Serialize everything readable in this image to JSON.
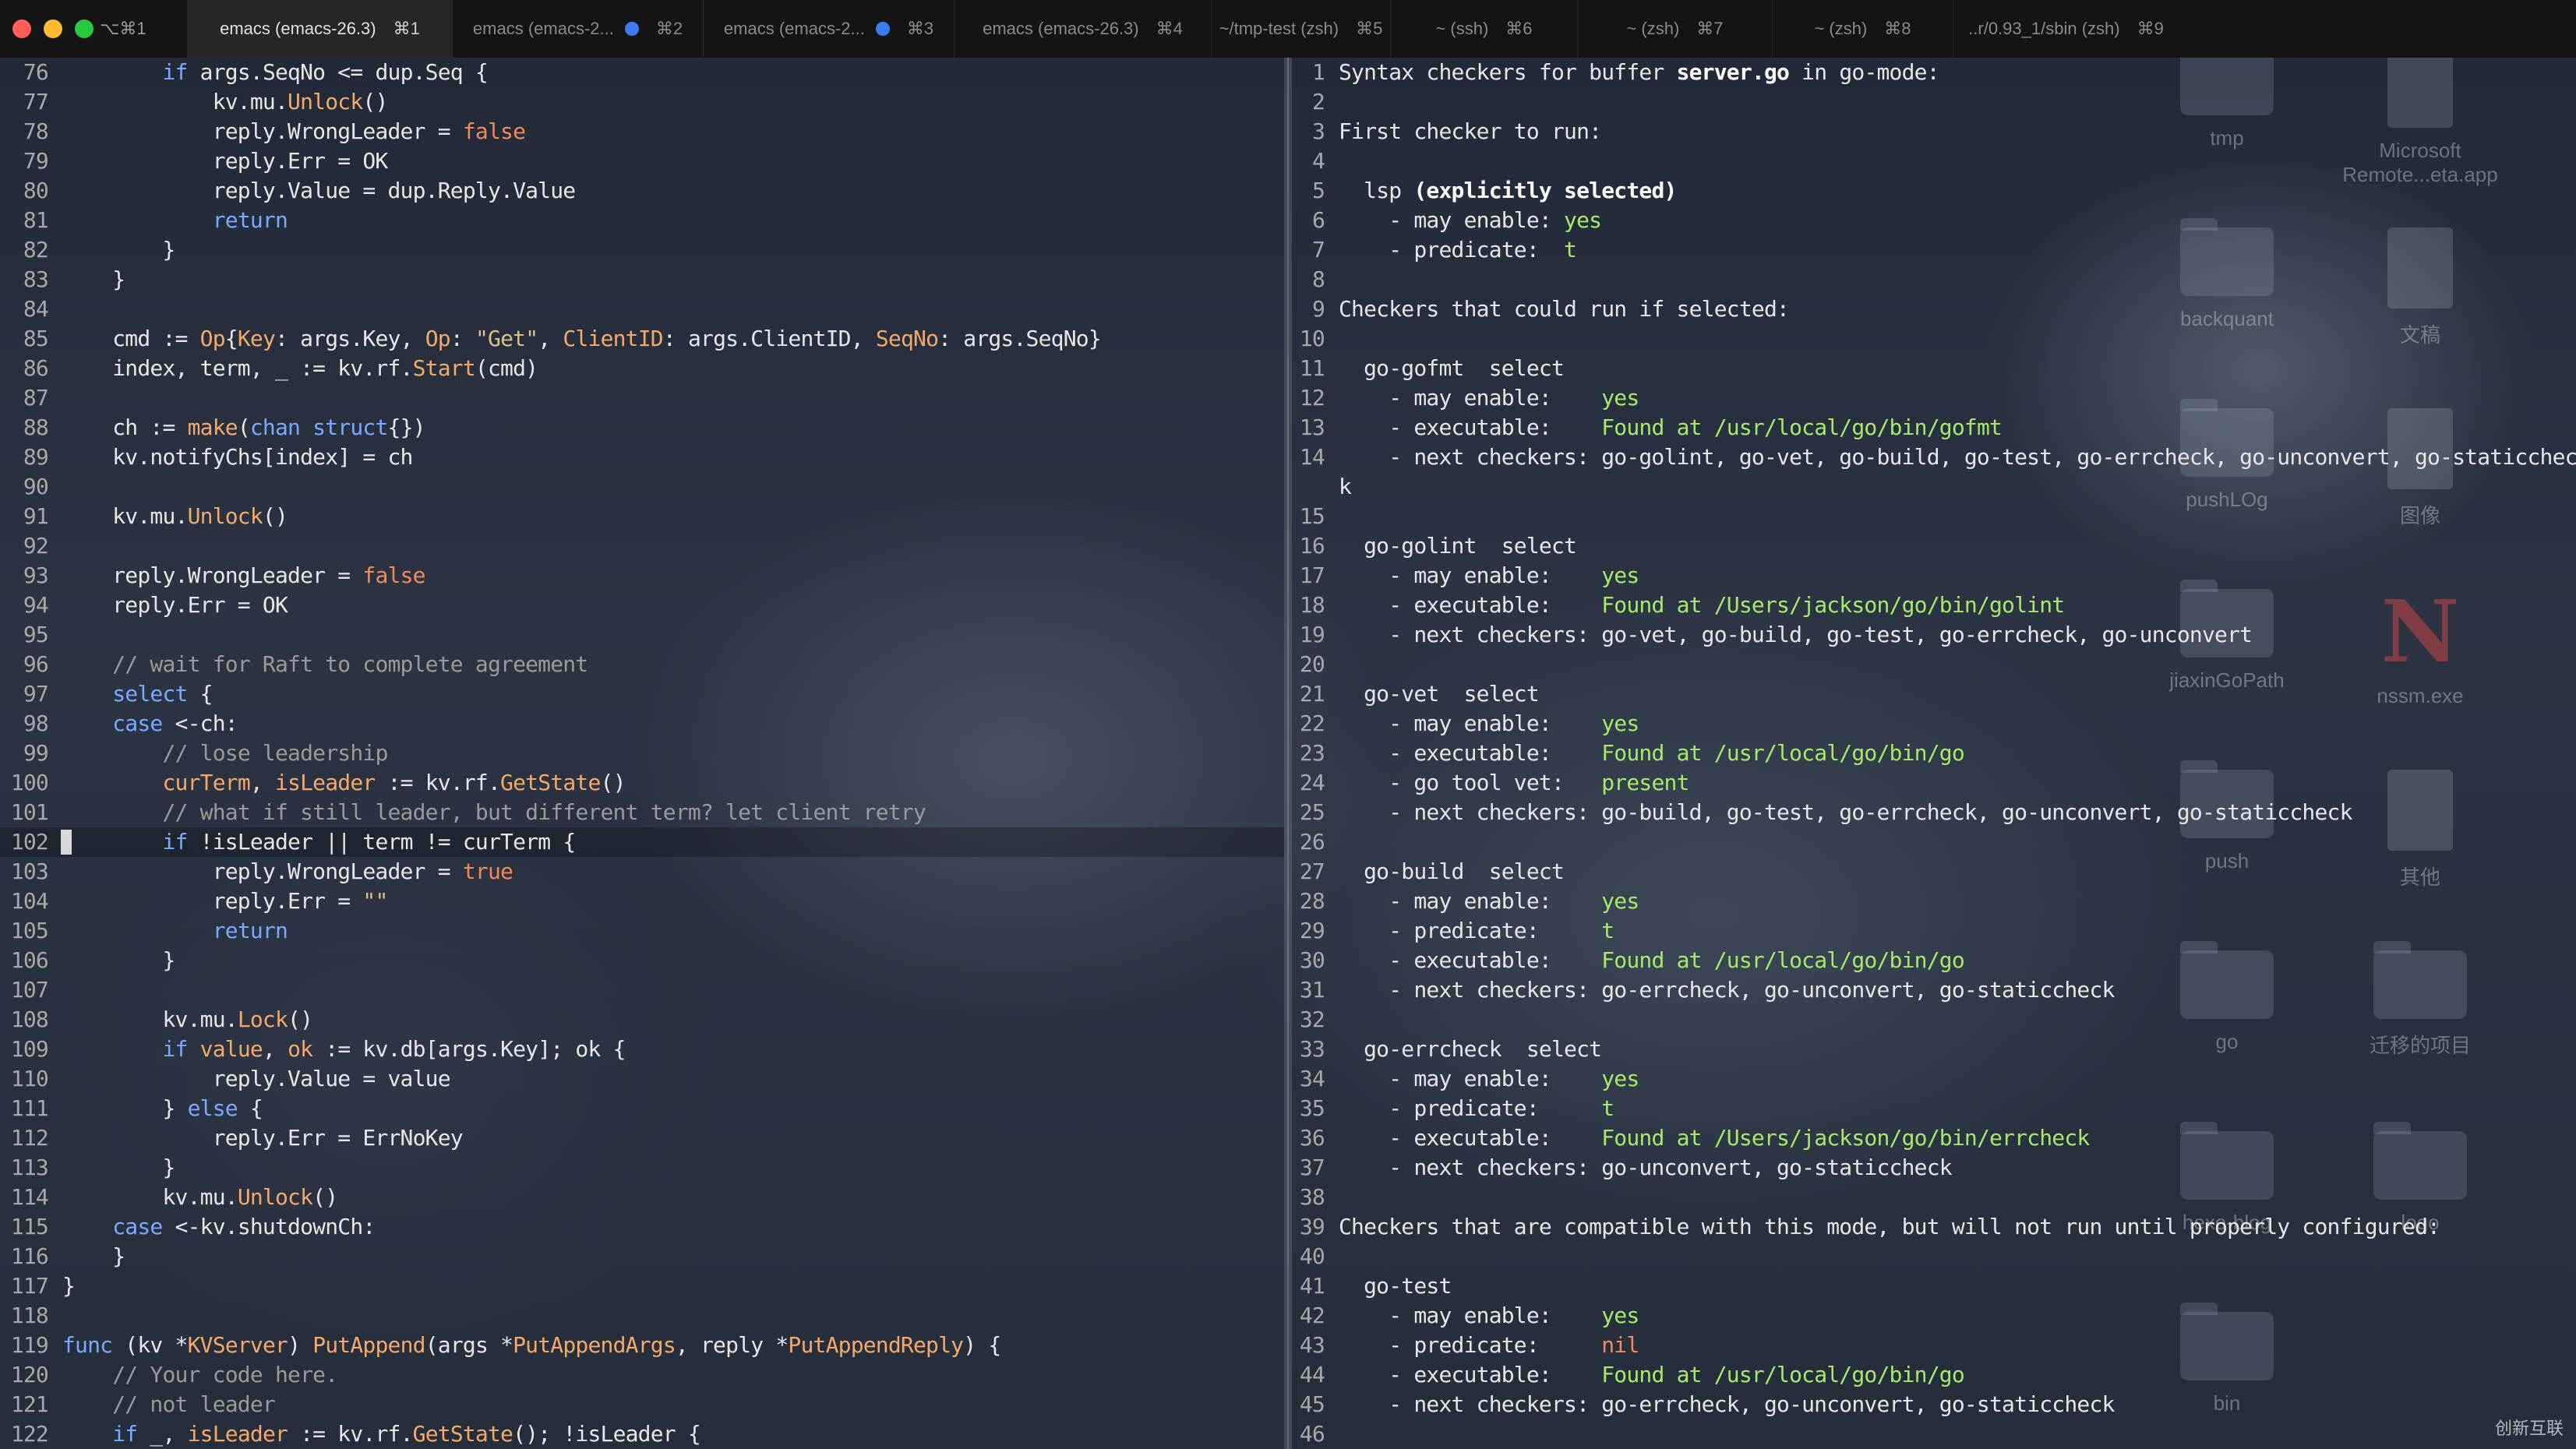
{
  "tabbar": {
    "first_tab": "⌥⌘1",
    "tabs": [
      {
        "title": "emacs (emacs-26.3)",
        "shortcut": "⌘1",
        "active": true,
        "dot": false
      },
      {
        "title": "emacs (emacs-2...",
        "shortcut": "⌘2",
        "active": false,
        "dot": true
      },
      {
        "title": "emacs (emacs-2...",
        "shortcut": "⌘3",
        "active": false,
        "dot": true
      },
      {
        "title": "emacs (emacs-26.3)",
        "shortcut": "⌘4",
        "active": false,
        "dot": false
      },
      {
        "title": "~/tmp-test (zsh)",
        "shortcut": "⌘5",
        "active": false,
        "dot": false
      },
      {
        "title": "~ (ssh)",
        "shortcut": "⌘6",
        "active": false,
        "dot": false
      },
      {
        "title": "~ (zsh)",
        "shortcut": "⌘7",
        "active": false,
        "dot": false
      },
      {
        "title": "~ (zsh)",
        "shortcut": "⌘8",
        "active": false,
        "dot": false
      },
      {
        "title": "..r/0.93_1/sbin (zsh)",
        "shortcut": "⌘9",
        "active": false,
        "dot": false
      }
    ]
  },
  "colors": {
    "close": "#ff5f57",
    "minimize": "#febc2e",
    "zoom": "#28c840",
    "keyword": "#7aa8ff",
    "function": "#f2a96a",
    "found": "#a6e86a"
  },
  "left_editor": {
    "cursor_line": 102,
    "lines": [
      {
        "n": 76,
        "code": "        <k>if</k> args.SeqNo <= dup.Seq {"
      },
      {
        "n": 77,
        "code": "            kv.mu.<f>Unlock</f>()"
      },
      {
        "n": 78,
        "code": "            reply.WrongLeader = <c>false</c>"
      },
      {
        "n": 79,
        "code": "            reply.Err = OK"
      },
      {
        "n": 80,
        "code": "            reply.Value = dup.Reply.Value"
      },
      {
        "n": 81,
        "code": "            <k>return</k>"
      },
      {
        "n": 82,
        "code": "        }"
      },
      {
        "n": 83,
        "code": "    }"
      },
      {
        "n": 84,
        "code": ""
      },
      {
        "n": 85,
        "code": "    cmd := <t>Op</t>{<t>Key</t>: args.Key, <t>Op</t>: <s>\"Get\"</s>, <t>ClientID</t>: args.ClientID, <t>SeqNo</t>: args.SeqNo}"
      },
      {
        "n": 86,
        "code": "    index, term, _ := kv.rf.<f>Start</f>(cmd)"
      },
      {
        "n": 87,
        "code": ""
      },
      {
        "n": 88,
        "code": "    ch := <f>make</f>(<k>chan</k> <k>struct</k>{})"
      },
      {
        "n": 89,
        "code": "    kv.notifyChs[index] = ch"
      },
      {
        "n": 90,
        "code": ""
      },
      {
        "n": 91,
        "code": "    kv.mu.<f>Unlock</f>()"
      },
      {
        "n": 92,
        "code": ""
      },
      {
        "n": 93,
        "code": "    reply.WrongLeader = <c>false</c>"
      },
      {
        "n": 94,
        "code": "    reply.Err = OK"
      },
      {
        "n": 95,
        "code": ""
      },
      {
        "n": 96,
        "code": "    <m>// wait for Raft to complete agreement</m>"
      },
      {
        "n": 97,
        "code": "    <k>select</k> {"
      },
      {
        "n": 98,
        "code": "    <k>case</k> <-ch:"
      },
      {
        "n": 99,
        "code": "        <m>// lose leadership</m>"
      },
      {
        "n": 100,
        "code": "        <t>curTerm</t>, <t>isLeader</t> := kv.rf.<f>GetState</f>()"
      },
      {
        "n": 101,
        "code": "        <m>// what if still leader, but different term? let client retry</m>"
      },
      {
        "n": 102,
        "code": "        <k>if</k> !isLeader || term != curTerm {"
      },
      {
        "n": 103,
        "code": "            reply.WrongLeader = <c>true</c>"
      },
      {
        "n": 104,
        "code": "            reply.Err = <s>\"\"</s>"
      },
      {
        "n": 105,
        "code": "            <k>return</k>"
      },
      {
        "n": 106,
        "code": "        }"
      },
      {
        "n": 107,
        "code": ""
      },
      {
        "n": 108,
        "code": "        kv.mu.<f>Lock</f>()"
      },
      {
        "n": 109,
        "code": "        <k>if</k> <t>value</t>, <t>ok</t> := kv.db[args.Key]; ok {"
      },
      {
        "n": 110,
        "code": "            reply.Value = value"
      },
      {
        "n": 111,
        "code": "        } <k>else</k> {"
      },
      {
        "n": 112,
        "code": "            reply.Err = ErrNoKey"
      },
      {
        "n": 113,
        "code": "        }"
      },
      {
        "n": 114,
        "code": "        kv.mu.<f>Unlock</f>()"
      },
      {
        "n": 115,
        "code": "    <k>case</k> <-kv.shutdownCh:"
      },
      {
        "n": 116,
        "code": "    }"
      },
      {
        "n": 117,
        "code": "}"
      },
      {
        "n": 118,
        "code": ""
      },
      {
        "n": 119,
        "code": "<k>func</k> (kv *<t>KVServer</t>) <f>PutAppend</f>(args *<t>PutAppendArgs</t>, reply *<t>PutAppendReply</t>) {"
      },
      {
        "n": 120,
        "code": "    <m>// Your code here.</m>"
      },
      {
        "n": 121,
        "code": "    <m>// not leader</m>"
      },
      {
        "n": 122,
        "code": "    <k>if</k> _, <t>isLeader</t> := kv.rf.<f>GetState</f>(); !isLeader {"
      }
    ]
  },
  "right_editor": {
    "lines": [
      {
        "n": "1",
        "code": "Syntax checkers for buffer <b>server.go</b> in go-mode:"
      },
      {
        "n": "2",
        "code": ""
      },
      {
        "n": "3",
        "code": "First checker to run:"
      },
      {
        "n": "4",
        "code": ""
      },
      {
        "n": "5",
        "code": "  lsp <b>(explicitly selected)</b>"
      },
      {
        "n": "6",
        "code": "    - may enable: <g>yes</g>"
      },
      {
        "n": "7",
        "code": "    - predicate:  <g>t</g>"
      },
      {
        "n": "8",
        "code": ""
      },
      {
        "n": "9",
        "code": "Checkers that could run if selected:"
      },
      {
        "n": "10",
        "code": ""
      },
      {
        "n": "11",
        "code": "  go-gofmt  select"
      },
      {
        "n": "12",
        "code": "    - may enable:    <g>yes</g>"
      },
      {
        "n": "13",
        "code": "    - executable:    <g>Found at /usr/local/go/bin/gofmt</g>"
      },
      {
        "n": "14",
        "code": "    - next checkers: go-golint, go-vet, go-build, go-test, go-errcheck, go-unconvert, go-staticchec"
      },
      {
        "n": "",
        "code": "k"
      },
      {
        "n": "15",
        "code": ""
      },
      {
        "n": "16",
        "code": "  go-golint  select"
      },
      {
        "n": "17",
        "code": "    - may enable:    <g>yes</g>"
      },
      {
        "n": "18",
        "code": "    - executable:    <g>Found at /Users/jackson/go/bin/golint</g>"
      },
      {
        "n": "19",
        "code": "    - next checkers: go-vet, go-build, go-test, go-errcheck, go-unconvert"
      },
      {
        "n": "20",
        "code": ""
      },
      {
        "n": "21",
        "code": "  go-vet  select"
      },
      {
        "n": "22",
        "code": "    - may enable:    <g>yes</g>"
      },
      {
        "n": "23",
        "code": "    - executable:    <g>Found at /usr/local/go/bin/go</g>"
      },
      {
        "n": "24",
        "code": "    - go tool vet:   <g>present</g>"
      },
      {
        "n": "25",
        "code": "    - next checkers: go-build, go-test, go-errcheck, go-unconvert, go-staticcheck"
      },
      {
        "n": "26",
        "code": ""
      },
      {
        "n": "27",
        "code": "  go-build  select"
      },
      {
        "n": "28",
        "code": "    - may enable:    <g>yes</g>"
      },
      {
        "n": "29",
        "code": "    - predicate:     <g>t</g>"
      },
      {
        "n": "30",
        "code": "    - executable:    <g>Found at /usr/local/go/bin/go</g>"
      },
      {
        "n": "31",
        "code": "    - next checkers: go-errcheck, go-unconvert, go-staticcheck"
      },
      {
        "n": "32",
        "code": ""
      },
      {
        "n": "33",
        "code": "  go-errcheck  select"
      },
      {
        "n": "34",
        "code": "    - may enable:    <g>yes</g>"
      },
      {
        "n": "35",
        "code": "    - predicate:     <g>t</g>"
      },
      {
        "n": "36",
        "code": "    - executable:    <g>Found at /Users/jackson/go/bin/errcheck</g>"
      },
      {
        "n": "37",
        "code": "    - next checkers: go-unconvert, go-staticcheck"
      },
      {
        "n": "38",
        "code": ""
      },
      {
        "n": "39",
        "code": "Checkers that are compatible with this mode, but will not run until properly configured:"
      },
      {
        "n": "40",
        "code": ""
      },
      {
        "n": "41",
        "code": "  go-test"
      },
      {
        "n": "42",
        "code": "    - may enable:    <g>yes</g>"
      },
      {
        "n": "43",
        "code": "    - predicate:     <n>nil</n>"
      },
      {
        "n": "44",
        "code": "    - executable:    <g>Found at /usr/local/go/bin/go</g>"
      },
      {
        "n": "45",
        "code": "    - next checkers: go-errcheck, go-unconvert, go-staticcheck"
      },
      {
        "n": "46",
        "code": ""
      }
    ]
  },
  "desktop": {
    "icons": [
      {
        "label": "tmp",
        "kind": "folder",
        "icon": "folder-icon"
      },
      {
        "label": "Microsoft Remote...eta.app",
        "kind": "app",
        "icon": "remote-desktop-icon"
      },
      {
        "label": "backquant",
        "kind": "folder",
        "icon": "folder-icon"
      },
      {
        "label": "文稿",
        "kind": "doc",
        "icon": "document-icon"
      },
      {
        "label": "pushLOg",
        "kind": "folder",
        "icon": "folder-icon"
      },
      {
        "label": "图像",
        "kind": "doc",
        "icon": "image-icon"
      },
      {
        "label": "jiaxinGoPath",
        "kind": "folder",
        "icon": "folder-icon"
      },
      {
        "label": "nssm.exe",
        "kind": "n",
        "icon": "nssm-icon"
      },
      {
        "label": "push",
        "kind": "folder",
        "icon": "folder-icon"
      },
      {
        "label": "其他",
        "kind": "app",
        "icon": "other-icon"
      },
      {
        "label": "go",
        "kind": "folder",
        "icon": "folder-icon"
      },
      {
        "label": "迁移的项目",
        "kind": "folder",
        "icon": "folder-icon"
      },
      {
        "label": "hexo-blog",
        "kind": "folder",
        "icon": "folder-icon"
      },
      {
        "label": "logo",
        "kind": "folder",
        "icon": "folder-icon"
      },
      {
        "label": "bin",
        "kind": "folder",
        "icon": "folder-icon"
      }
    ],
    "watermark": "创新互联"
  }
}
